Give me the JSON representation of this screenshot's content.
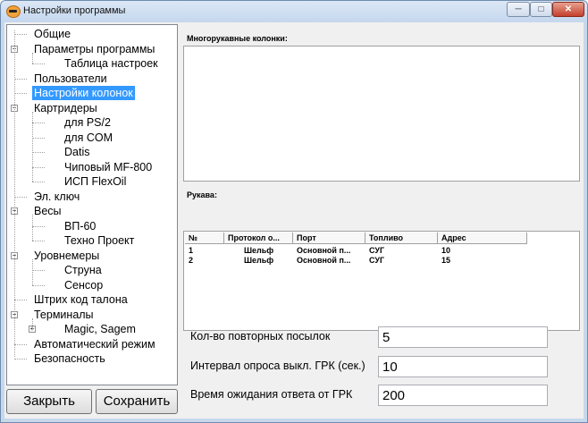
{
  "window": {
    "title": "Настройки программы",
    "controls": {
      "minimize": "─",
      "maximize": "□",
      "close": "✕"
    }
  },
  "tree": {
    "items": [
      {
        "label": "Общие",
        "level": 0,
        "expander": ""
      },
      {
        "label": "Параметры программы",
        "level": 0,
        "expander": "−"
      },
      {
        "label": "Таблица настроек",
        "level": 1,
        "expander": ""
      },
      {
        "label": "Пользователи",
        "level": 0,
        "expander": ""
      },
      {
        "label": "Настройки колонок",
        "level": 0,
        "expander": "",
        "selected": true
      },
      {
        "label": "Картридеры",
        "level": 0,
        "expander": "−"
      },
      {
        "label": "для PS/2",
        "level": 1,
        "expander": ""
      },
      {
        "label": "для COM",
        "level": 1,
        "expander": ""
      },
      {
        "label": "Datis",
        "level": 1,
        "expander": ""
      },
      {
        "label": "Чиповый MF-800",
        "level": 1,
        "expander": ""
      },
      {
        "label": "ИСП FlexOil",
        "level": 1,
        "expander": ""
      },
      {
        "label": "Эл. ключ",
        "level": 0,
        "expander": ""
      },
      {
        "label": "Весы",
        "level": 0,
        "expander": "−"
      },
      {
        "label": "ВП-60",
        "level": 1,
        "expander": ""
      },
      {
        "label": "Техно Проект",
        "level": 1,
        "expander": ""
      },
      {
        "label": "Уровнемеры",
        "level": 0,
        "expander": "−"
      },
      {
        "label": "Струна",
        "level": 1,
        "expander": ""
      },
      {
        "label": "Сенсор",
        "level": 1,
        "expander": ""
      },
      {
        "label": "Штрих код талона",
        "level": 0,
        "expander": ""
      },
      {
        "label": "Терминалы",
        "level": 0,
        "expander": "−"
      },
      {
        "label": "Magic, Sagem",
        "level": 1,
        "expander": "+"
      },
      {
        "label": "Автоматический режим",
        "level": 0,
        "expander": ""
      },
      {
        "label": "Безопасность",
        "level": 0,
        "expander": ""
      }
    ]
  },
  "buttons": {
    "close_label": "Закрыть",
    "save_label": "Сохранить"
  },
  "multi_hose": {
    "label": "Многорукавные колонки:"
  },
  "hoses": {
    "label": "Рукава:",
    "columns": [
      "№",
      "Протокол о...",
      "Порт",
      "Топливо",
      "Адрес"
    ],
    "rows": [
      [
        "1",
        "Шельф",
        "Основной п...",
        "СУГ",
        "10"
      ],
      [
        "2",
        "Шельф",
        "Основной п...",
        "СУГ",
        "15"
      ]
    ]
  },
  "fields": {
    "retries_label": "Кол-во повторных посылок",
    "retries_value": "5",
    "poll_label": "Интервал опроса выкл. ГРК (сек.)",
    "poll_value": "10",
    "timeout_label": "Время ожидания ответа от ГРК",
    "timeout_value": "200"
  }
}
